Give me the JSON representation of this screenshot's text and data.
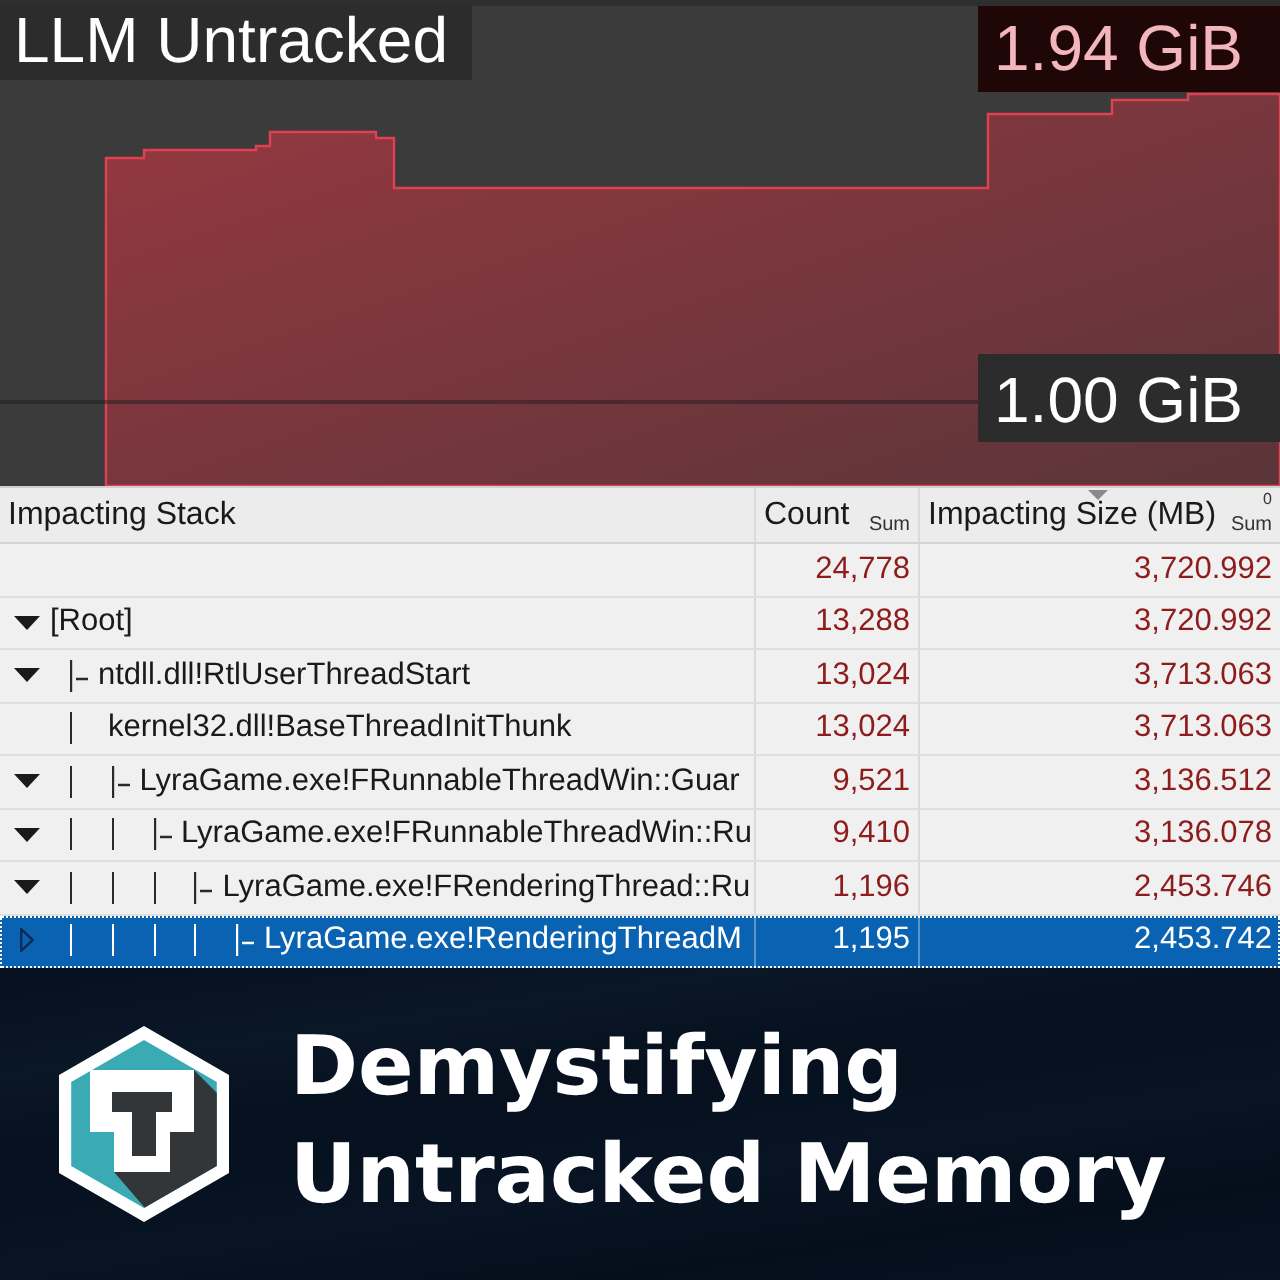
{
  "graph": {
    "title": "LLM Untracked",
    "current_value": "1.94 GiB",
    "gridline_label": "1.00 GiB"
  },
  "table": {
    "columns": [
      {
        "label": "Impacting Stack",
        "sorted": false
      },
      {
        "label": "Count",
        "aggregate": "Sum",
        "sorted": false
      },
      {
        "label": "Impacting Size (MB)",
        "aggregate": "Sum",
        "sort_rank": "0",
        "sorted": true
      }
    ],
    "total": {
      "count": "24,778",
      "size": "3,720.992"
    },
    "tree": [
      {
        "kind": "branch",
        "label": "[Root]",
        "expanded": true,
        "selected": false,
        "count": "13,288",
        "size": "3,720.992",
        "children": [
          {
            "kind": "branch",
            "label": "ntdll.dll!RtlUserThreadStart",
            "expanded": true,
            "selected": false,
            "count": "13,024",
            "size": "3,713.063",
            "children": [
              {
                "kind": "chain",
                "label": "kernel32.dll!BaseThreadInitThunk",
                "selected": false,
                "count": "13,024",
                "size": "3,713.063",
                "children": [
                  {
                    "kind": "branch",
                    "label": "LyraGame.exe!FRunnableThreadWin::Guar",
                    "expanded": true,
                    "selected": false,
                    "count": "9,521",
                    "size": "3,136.512",
                    "children": [
                      {
                        "kind": "branch",
                        "label": "LyraGame.exe!FRunnableThreadWin::Ru",
                        "expanded": true,
                        "selected": false,
                        "count": "9,410",
                        "size": "3,136.078",
                        "children": [
                          {
                            "kind": "branch",
                            "label": "LyraGame.exe!FRenderingThread::Ru",
                            "expanded": true,
                            "selected": false,
                            "count": "1,196",
                            "size": "2,453.746",
                            "children": [
                              {
                                "kind": "branch",
                                "label": "LyraGame.exe!RenderingThreadM",
                                "expanded": false,
                                "selected": true,
                                "count": "1,195",
                                "size": "2,453.742"
                              }
                            ]
                          }
                        ]
                      }
                    ]
                  }
                ]
              }
            ]
          }
        ]
      }
    ]
  },
  "banner": {
    "title": "Demystifying Untracked Memory"
  }
}
